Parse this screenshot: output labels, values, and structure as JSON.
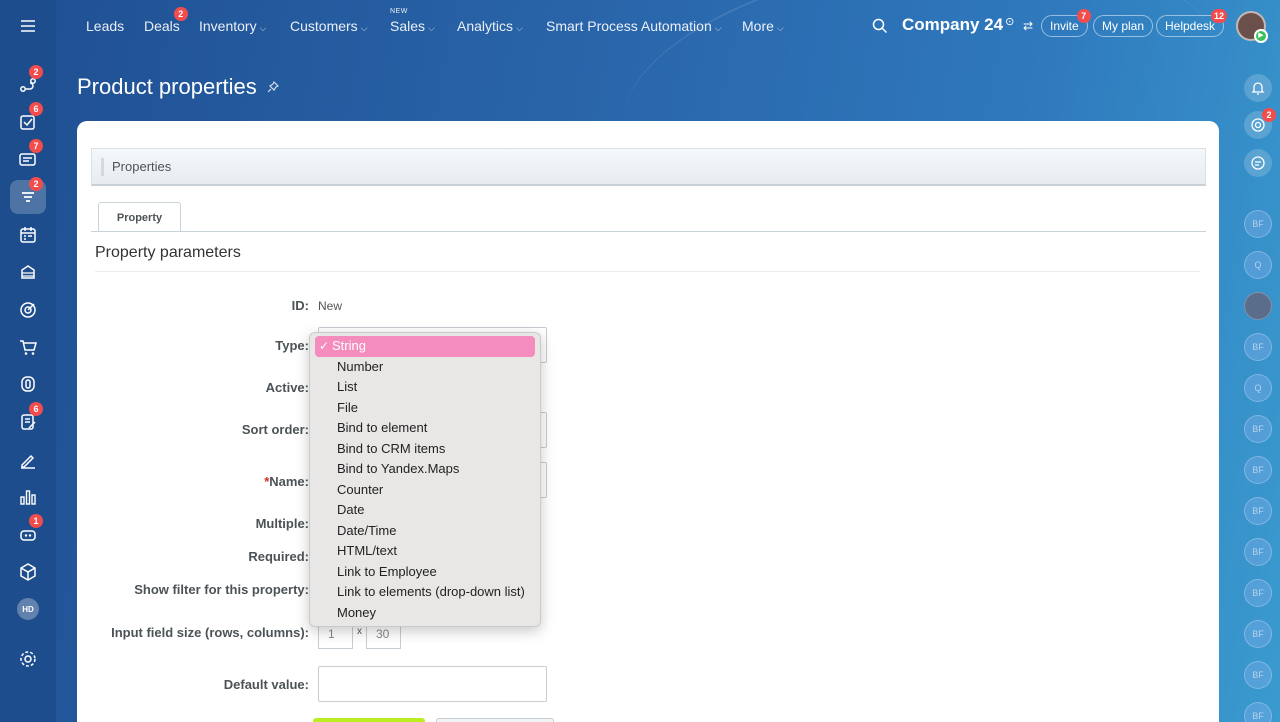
{
  "topnav": {
    "items": [
      {
        "label": "Leads",
        "badge": "",
        "has_chevron": false,
        "tag": ""
      },
      {
        "label": "Deals",
        "badge": "2",
        "has_chevron": false,
        "tag": ""
      },
      {
        "label": "Inventory",
        "badge": "",
        "has_chevron": true,
        "tag": ""
      },
      {
        "label": "Customers",
        "badge": "",
        "has_chevron": true,
        "tag": ""
      },
      {
        "label": "Sales",
        "badge": "",
        "has_chevron": true,
        "tag": "NEW"
      },
      {
        "label": "Analytics",
        "badge": "",
        "has_chevron": true,
        "tag": ""
      },
      {
        "label": "Smart Process Automation",
        "badge": "",
        "has_chevron": true,
        "tag": ""
      },
      {
        "label": "More",
        "badge": "",
        "has_chevron": true,
        "tag": ""
      }
    ],
    "company": "Company 24",
    "invite": {
      "label": "Invite",
      "badge": "7"
    },
    "my_plan": "My plan",
    "helpdesk": {
      "label": "Helpdesk",
      "badge": "12"
    }
  },
  "left_sidebar": {
    "items": [
      {
        "icon": "menu-icon",
        "badge": ""
      },
      {
        "icon": "pipeline-icon",
        "badge": "2"
      },
      {
        "icon": "tasks-icon",
        "badge": "6"
      },
      {
        "icon": "chat-icon",
        "badge": "7"
      },
      {
        "icon": "crm-filter-icon",
        "badge": "2",
        "active": true
      },
      {
        "icon": "calendar-icon",
        "badge": ""
      },
      {
        "icon": "drive-icon",
        "badge": ""
      },
      {
        "icon": "target-icon",
        "badge": ""
      },
      {
        "icon": "cart-icon",
        "badge": ""
      },
      {
        "icon": "contact-center-icon",
        "badge": ""
      },
      {
        "icon": "documents-icon",
        "badge": "6"
      },
      {
        "icon": "sign-icon",
        "badge": ""
      },
      {
        "icon": "analytics-icon",
        "badge": ""
      },
      {
        "icon": "robot-icon",
        "badge": "1"
      },
      {
        "icon": "box-icon",
        "badge": ""
      },
      {
        "icon": "hd-avatar",
        "badge": "",
        "text": "HD"
      },
      {
        "icon": "settings-icon",
        "badge": ""
      }
    ]
  },
  "right_sidebar": {
    "targets_badge": "2",
    "avatars": [
      "BF",
      "Q",
      "",
      "BF",
      "Q",
      "BF",
      "BF",
      "BF",
      "BF",
      "BF",
      "BF",
      "BF",
      "BF"
    ]
  },
  "page": {
    "title": "Product properties"
  },
  "panel": {
    "header": "Properties",
    "tab_label": "Property",
    "section_title": "Property parameters"
  },
  "form": {
    "id_label": "ID:",
    "id_value": "New",
    "type_label": "Type:",
    "active_label": "Active:",
    "sort_label": "Sort order:",
    "name_required_mark": "*",
    "name_label": "Name:",
    "multiple_label": "Multiple:",
    "required_label": "Required:",
    "filter_label": "Show filter for this property:",
    "size_label": "Input field size (rows, columns):",
    "rows_value": "1",
    "size_separator": "x",
    "cols_value": "30",
    "default_label": "Default value:"
  },
  "type_dropdown": {
    "selected": "String",
    "check": "✓",
    "options": [
      "String",
      "Number",
      "List",
      "File",
      "Bind to element",
      "Bind to CRM items",
      "Bind to Yandex.Maps",
      "Counter",
      "Date",
      "Date/Time",
      "HTML/text",
      "Link to Employee",
      "Link to elements (drop-down list)",
      "Money"
    ]
  }
}
